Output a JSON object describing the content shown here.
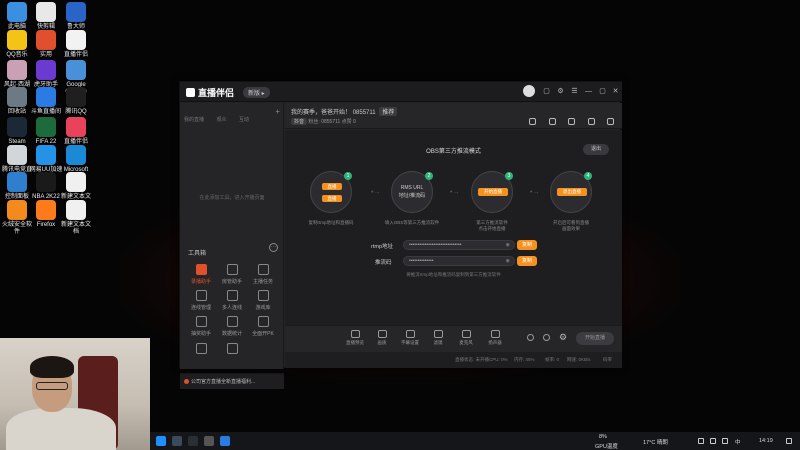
{
  "desktop": {
    "icons": [
      {
        "label": "此电脑",
        "color": "#3a8fe0"
      },
      {
        "label": "QQ音乐",
        "color": "#f3c318"
      },
      {
        "label": "风起·西湖",
        "color": "#c9a0b6"
      },
      {
        "label": "回收站",
        "color": "#6c7a86"
      },
      {
        "label": "Steam",
        "color": "#1b2838"
      },
      {
        "label": "腾讯电竞直播",
        "color": "#d0d6da"
      },
      {
        "label": "控制面板",
        "color": "#2f7fcf"
      },
      {
        "label": "火绒安全软件",
        "color": "#f28a1e"
      },
      {
        "label": "快剪辑",
        "color": "#e8e8e8"
      },
      {
        "label": "实用",
        "color": "#e04f2e"
      },
      {
        "label": "虎牙助手",
        "color": "#6b3bd1"
      },
      {
        "label": "斗鱼直播间",
        "color": "#2a7be4"
      },
      {
        "label": "FIFA 22",
        "color": "#1d6b3a"
      },
      {
        "label": "网易UU加速器",
        "color": "#2492e6"
      },
      {
        "label": "NBA 2K22",
        "color": "#1a1a1a"
      },
      {
        "label": "Firefox",
        "color": "#ff7a1a"
      },
      {
        "label": "鲁大师",
        "color": "#2a64c8"
      },
      {
        "label": "直播伴侣",
        "color": "#f2f2f2"
      },
      {
        "label": "Google Chrome",
        "color": "#4a90d9"
      },
      {
        "label": "腾讯QQ",
        "color": "#1f1f1f"
      },
      {
        "label": "直播伴侣",
        "color": "#e9435b"
      },
      {
        "label": "Microsoft Edge",
        "color": "#1a8ad6"
      },
      {
        "label": "新建文本文档",
        "color": "#f0f0f0"
      },
      {
        "label": "新建文本文档",
        "color": "#f0f0f0"
      }
    ]
  },
  "app": {
    "title": "直播伴侣",
    "version_badge": "新版 ▸",
    "titlebar_buttons": [
      "▢",
      "⚙",
      "☰",
      "—",
      "▢",
      "✕"
    ]
  },
  "left_panel": {
    "tabs": [
      "我的直播",
      "观众",
      "互动"
    ],
    "add_tab": "+",
    "empty_hint": "在此添加工具，进入开播页面",
    "toolbox_title": "工具箱",
    "toolbox_more": "···",
    "tools": [
      {
        "label": "录播助手",
        "active": true
      },
      {
        "label": "房管助手",
        "active": false
      },
      {
        "label": "主播任务",
        "active": false
      },
      {
        "label": "连线管理",
        "active": false
      },
      {
        "label": "多人连线",
        "active": false
      },
      {
        "label": "游戏库",
        "active": false
      },
      {
        "label": "抽奖助手",
        "active": false
      },
      {
        "label": "数据统计",
        "active": false
      },
      {
        "label": "全面开PK",
        "active": false
      },
      {
        "label": "",
        "active": false
      },
      {
        "label": "",
        "active": false
      }
    ],
    "notice": "公司官方直播全新直播福利..."
  },
  "stream_info": {
    "line1_prefix": "我的赛季，爸爸开始！",
    "room_id": "0855711",
    "line1_chip": "推荐",
    "line2_prefix": "抖音",
    "line2_followers": "粉丝: 0855711",
    "line2_likes": "点赞 0"
  },
  "content": {
    "mode_title": "OBS第三方推流模式",
    "exit_label": "退出",
    "steps": [
      {
        "num": "1",
        "pill1": "直播",
        "pill2": "直播",
        "text": "",
        "desc": "复制rtmp地址和直播码"
      },
      {
        "num": "2",
        "text": "RMS URL\n地址/推流码",
        "desc": "填入OBS等第三方推流软件"
      },
      {
        "num": "3",
        "pill": "开始直播",
        "text": "",
        "desc": "第三方推流软件\n点击开始直播"
      },
      {
        "num": "4",
        "pill": "退出直播",
        "text": "",
        "desc": "开启后可看到直播\n画面效果"
      }
    ],
    "rtmp_label": "rtmp地址",
    "rtmp_value": "••••••••••••••••••••••••••••••",
    "stream_key_label": "推流码",
    "stream_key_value": "••••••••••••••",
    "copy_label": "复制",
    "hint": "将推流rtmp地址和推流码复制到第三方推流软件"
  },
  "bottom_bar": {
    "tools": [
      "直播预览",
      "画质",
      "字幕设置",
      "滤镜",
      "麦克风",
      "扬声器"
    ],
    "start_label": "开始直播"
  },
  "status_bar": {
    "items": [
      "直播状态: 未开播",
      "CPU: 0%",
      "内存: 45%",
      "帧率: 0",
      "网速: 0KB/s",
      "码率"
    ]
  },
  "taskbar": {
    "gpu": "8%",
    "gpu_label": "GPU温度",
    "weather": "17°C 晴朗",
    "time": "14:19",
    "ime": "中"
  }
}
